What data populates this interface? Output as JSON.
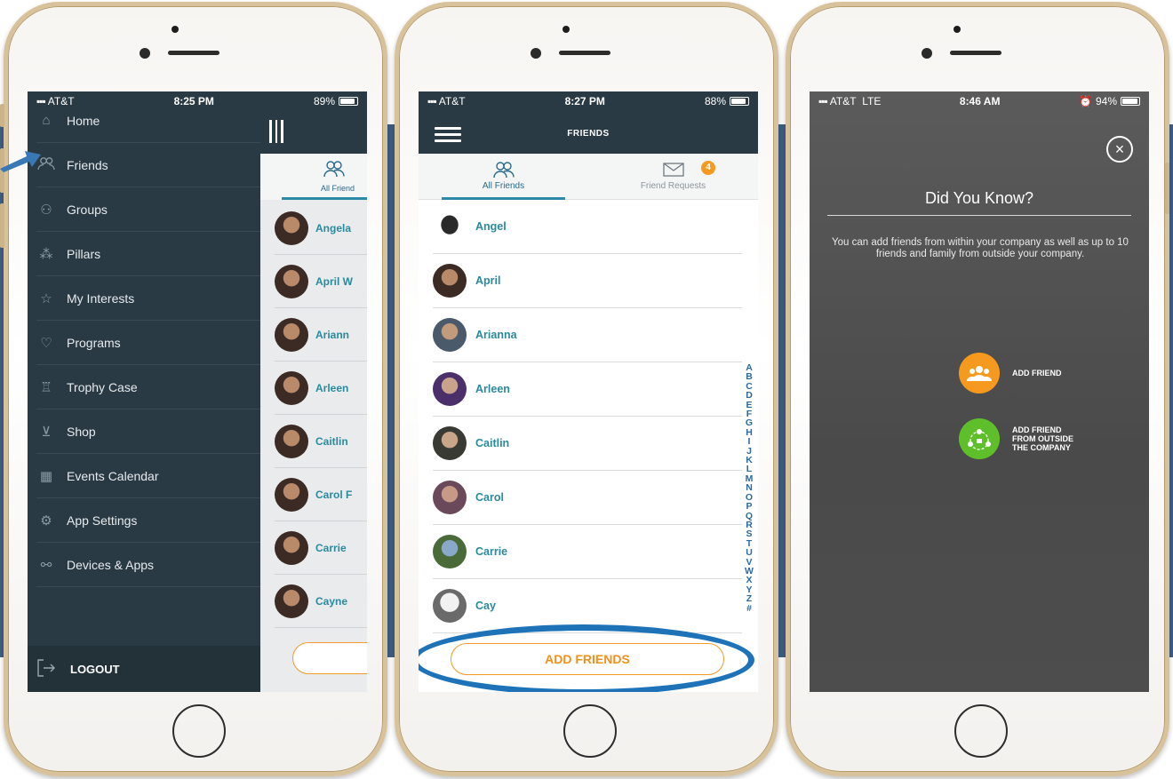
{
  "colors": {
    "brand_dark": "#2a3a44",
    "accent_teal": "#2a8a9e",
    "accent_orange": "#f0901a",
    "accent_green": "#5fbf2a",
    "highlight_blue": "#1e73b8",
    "background_stripe": "#3f5f86"
  },
  "phone1": {
    "status": {
      "carrier": "AT&T",
      "time": "8:25 PM",
      "battery": "89%",
      "battery_level": 0.89
    },
    "menu": [
      {
        "label": "Home",
        "icon": "home-icon"
      },
      {
        "label": "Friends",
        "icon": "friends-icon"
      },
      {
        "label": "Groups",
        "icon": "groups-icon"
      },
      {
        "label": "Pillars",
        "icon": "pillars-icon"
      },
      {
        "label": "My Interests",
        "icon": "star-icon"
      },
      {
        "label": "Programs",
        "icon": "heart-pulse-icon"
      },
      {
        "label": "Trophy Case",
        "icon": "trophy-icon"
      },
      {
        "label": "Shop",
        "icon": "cart-icon"
      },
      {
        "label": "Events Calendar",
        "icon": "calendar-icon"
      },
      {
        "label": "App Settings",
        "icon": "gear-icon"
      },
      {
        "label": "Devices & Apps",
        "icon": "link-icon"
      }
    ],
    "logout": "LOGOUT",
    "behind_tab": "All Friend",
    "behind_rows": [
      "Angela",
      "April W",
      "Ariann",
      "Arleen",
      "Caitlin",
      "Carol F",
      "Carrie",
      "Cayne"
    ]
  },
  "phone2": {
    "status": {
      "carrier": "AT&T",
      "time": "8:27 PM",
      "battery": "88%",
      "battery_level": 0.88
    },
    "title": "FRIENDS",
    "tabs": [
      {
        "label": "All Friends",
        "icon": "friends-icon"
      },
      {
        "label": "Friend Requests",
        "icon": "envelope-icon",
        "badge": "4"
      }
    ],
    "friends": [
      "Angel",
      "April",
      "Arianna",
      "Arleen",
      "Caitlin",
      "Carol",
      "Carrie",
      "Cay"
    ],
    "alphabet": [
      "A",
      "B",
      "C",
      "D",
      "E",
      "F",
      "G",
      "H",
      "I",
      "J",
      "K",
      "L",
      "M",
      "N",
      "O",
      "P",
      "Q",
      "R",
      "S",
      "T",
      "U",
      "V",
      "W",
      "X",
      "Y",
      "Z",
      "#"
    ],
    "add_button": "ADD FRIENDS"
  },
  "phone3": {
    "status": {
      "carrier": "AT&T",
      "network": "LTE",
      "time": "8:46 AM",
      "battery": "94%",
      "battery_level": 0.94
    },
    "heading": "Did You Know?",
    "body": "You can add friends from within your company as well as up to 10 friends and family from outside your company.",
    "actions": [
      {
        "label": "ADD FRIEND",
        "icon": "add-friend-icon",
        "color": "#f59a1e"
      },
      {
        "label_lines": [
          "ADD FRIEND",
          "FROM OUTSIDE",
          "THE COMPANY"
        ],
        "icon": "add-outside-icon",
        "color": "#5fbf2a"
      }
    ]
  }
}
